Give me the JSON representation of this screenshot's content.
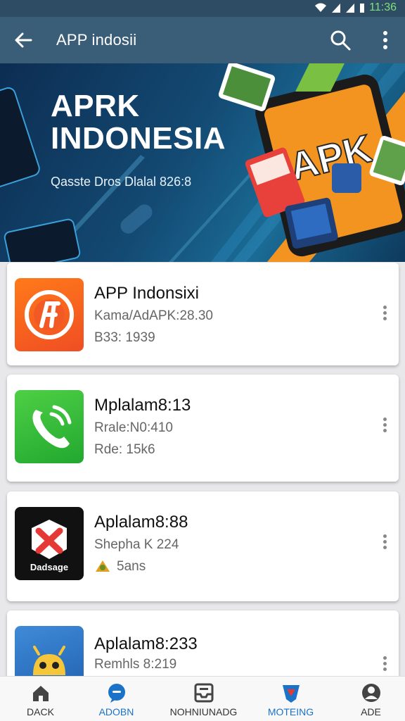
{
  "status_bar": {
    "time": "11:36"
  },
  "app_bar": {
    "title": "APP indosii"
  },
  "banner": {
    "title_line1": "APRK",
    "title_line2": "INDONESIA",
    "subtitle": "Qasste Dros Dlalal 826:8",
    "badge_text": "APK"
  },
  "apps": [
    {
      "name": "APP Indonsixi",
      "meta1": "Kama/AdAPK:28.30",
      "meta2": "B33: 1939"
    },
    {
      "name": "Mplalam8:13",
      "meta1": "Rrale:N0:410",
      "meta2": "Rde: 15k6"
    },
    {
      "name": "Aplalam8:88",
      "meta1": "Shepha K 224",
      "meta2": "5ans",
      "icon_label": "Dadsage"
    },
    {
      "name": "Aplalam8:233",
      "meta1": "Remhls 8:219",
      "meta2": ""
    }
  ],
  "bottom_nav": [
    {
      "label": "DACK",
      "icon": "home-icon"
    },
    {
      "label": "ADOBN",
      "icon": "chat-icon"
    },
    {
      "label": "NOHNIUNADG",
      "icon": "inbox-icon"
    },
    {
      "label": "MOTEING",
      "icon": "shield-icon"
    },
    {
      "label": "ADE",
      "icon": "account-icon"
    }
  ],
  "colors": {
    "app_bar": "#3a5d78",
    "status_bar": "#2e4c63",
    "accent": "#1a73c9",
    "banner_orange": "#f39420"
  }
}
